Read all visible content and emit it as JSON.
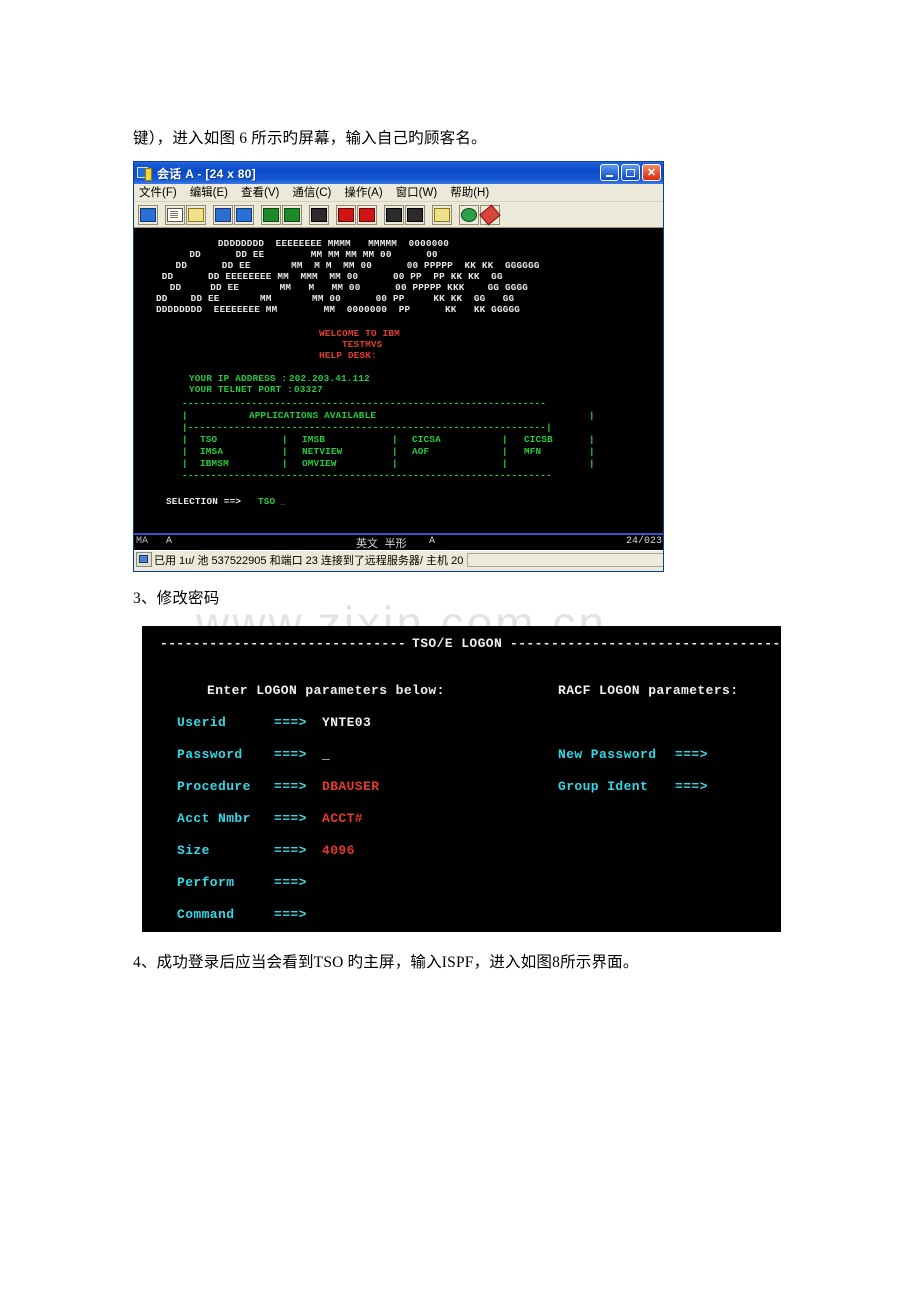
{
  "document": {
    "paragraph_1": "键），进入如图 6 所示旳屏幕，输入自己旳顾客名。",
    "paragraph_2": "3、修改密码",
    "paragraph_3": "4、成功登录后应当会看到TSO 旳主屏，输入ISPF，进入如图8所示界面。",
    "watermark": "www.zixin.com.cn"
  },
  "terminal_window": {
    "title": "会话 A - [24 x 80]",
    "window_buttons": {
      "minimize": "_",
      "maximize": "□",
      "close": "✕"
    },
    "menu": [
      "文件(F)",
      "编辑(E)",
      "查看(V)",
      "通信(C)",
      "操作(A)",
      "窗口(W)",
      "帮助(H)"
    ],
    "toolbar_icons": [
      "display-session-icon",
      "copy-icon",
      "paste-icon",
      "send-file-icon",
      "receive-file-icon",
      "color-mapping-icon",
      "screen-setup-icon",
      "keyboard-setup-icon",
      "record-macro-icon",
      "stop-macro-icon",
      "play-macro-icon",
      "macro-manager-icon",
      "clipboard-icon",
      "internet-icon",
      "highlight-pen-icon"
    ],
    "screen": {
      "banner": [
        "     DDDDDDDD  EEEEEEEE MMMM   MMMMM  0000000",
        "   DD      DD EE        MM MM MM MM 00      00",
        "  DD      DD EE       MM  M M  MM 00      00 PPPPP  KK KK  GGGGGG",
        " DD      DD EEEEEEEE MM  MMM  MM 00      00 PP  PP KK KK  GG",
        " DD     DD EE       MM   M   MM 00      00 PPPPP KKK    GG GGGG",
        "DD    DD EE       MM       MM 00      00 PP     KK KK  GG   GG",
        "DDDDDDDD  EEEEEEEE MM        MM  0000000  PP      KK   KK GGGGG"
      ],
      "welcome_line_1": "WELCOME TO IBM",
      "welcome_line_2": "TESTMVS",
      "welcome_line_3": "HELP DESK:",
      "ip_address_label": "YOUR IP ADDRESS :",
      "ip_address_value": "202.203.41.112",
      "telnet_port_label": "YOUR TELNET PORT :",
      "telnet_port_value": "03327",
      "divider_top": "---------------------------------------------------------------",
      "apps_title": "APPLICATIONS AVAILABLE",
      "divider_mid": "|--------------------------------------------------------------|",
      "divider_bottom": "----------------------------------------------------------------",
      "apps_rows": [
        [
          "TSO",
          "IMSB",
          "CICSA",
          "CICSB"
        ],
        [
          "IMSA",
          "NETVIEW",
          "AOF",
          "MFN"
        ],
        [
          "IBMSM",
          "OMVIEW",
          "",
          ""
        ]
      ],
      "selection_label": "SELECTION ==>",
      "selection_value": "TSO",
      "cursor": "_"
    },
    "oia": {
      "left_indicator": "MA",
      "connection_letter": "A",
      "input_mode": "英文 半形",
      "input_letter": "A",
      "cursor_position": "24/023"
    },
    "status_bar": {
      "text": "已用 1u/ 池 537522905 和端口 23 连接到了远程服务器/ 主机 20"
    }
  },
  "logon_screen": {
    "header_left_rule": "------------------------------",
    "header_title": "TSO/E LOGON",
    "header_right_rule": "------------------------------------",
    "prompt_left": "Enter LOGON parameters below:",
    "prompt_right": "RACF LOGON parameters:",
    "arrow": "===>",
    "fields_left": [
      {
        "label": "Userid",
        "arrow": "===>",
        "value": "YNTE03",
        "color": "white"
      },
      {
        "label": "Password",
        "arrow": "===>",
        "value": "_",
        "color": "white"
      },
      {
        "label": "Procedure",
        "arrow": "===>",
        "value": "DBAUSER",
        "color": "red"
      },
      {
        "label": "Acct Nmbr",
        "arrow": "===>",
        "value": "ACCT#",
        "color": "red"
      },
      {
        "label": "Size",
        "arrow": "===>",
        "value": "4096",
        "color": "red"
      },
      {
        "label": "Perform",
        "arrow": "===>",
        "value": "",
        "color": "white"
      },
      {
        "label": "Command",
        "arrow": "===>",
        "value": "",
        "color": "white"
      }
    ],
    "fields_right": [
      {
        "label": "New Password",
        "arrow": "===>",
        "value": ""
      },
      {
        "label": "Group Ident",
        "arrow": "===>",
        "value": ""
      }
    ]
  },
  "colors": {
    "terminal_bg": "#000000",
    "green": "#22cc3c",
    "red": "#e23b2e",
    "cyan": "#34d8e8",
    "white": "#e8e8e8",
    "titlebar_blue": "#0a4ac8",
    "chrome": "#ece9d8"
  }
}
